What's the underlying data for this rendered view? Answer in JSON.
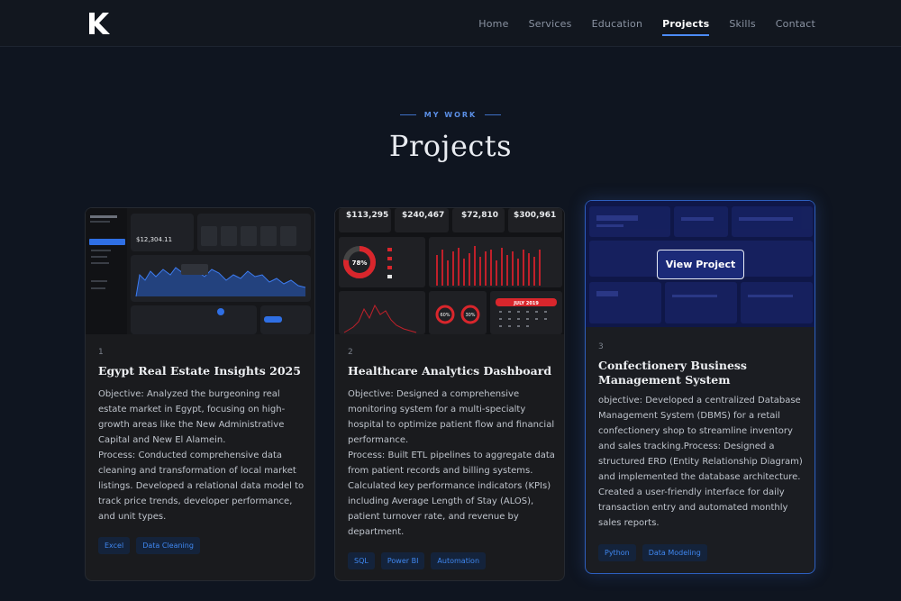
{
  "nav": {
    "items": [
      {
        "label": "Home"
      },
      {
        "label": "Services"
      },
      {
        "label": "Education"
      },
      {
        "label": "Projects",
        "active": true
      },
      {
        "label": "Skills"
      },
      {
        "label": "Contact"
      }
    ]
  },
  "section": {
    "eyebrow": "MY WORK",
    "title": "Projects"
  },
  "projects": [
    {
      "number": "1",
      "title": "Egypt Real Estate Insights 2025",
      "description": "Objective: Analyzed the burgeoning real estate market in Egypt, focusing on high-growth areas like the New Administrative Capital and New El Alamein.\nProcess: Conducted comprehensive data cleaning and transformation of local market listings. Developed a relational data model to track price trends, developer performance, and unit types.",
      "tags": [
        "Excel",
        "Data Cleaning"
      ],
      "thumb": {
        "kpi": "$12,304.11"
      }
    },
    {
      "number": "2",
      "title": "Healthcare Analytics Dashboard",
      "description": "Objective: Designed a comprehensive monitoring system for a multi-specialty hospital to optimize patient flow and financial performance.\nProcess: Built ETL pipelines to aggregate data from patient records and billing systems. Calculated key performance indicators (KPIs) including Average Length of Stay (ALOS), patient turnover rate, and revenue by department.",
      "tags": [
        "SQL",
        "Power BI",
        "Automation"
      ],
      "thumb": {
        "kpis": [
          "$113,295",
          "$240,467",
          "$72,810",
          "$300,961"
        ],
        "donut": "78%",
        "g1": "60%",
        "g2": "30%",
        "month": "JULY 2019"
      }
    },
    {
      "number": "3",
      "title": "Confectionery Business Management System",
      "description": "objective: Developed a centralized Database Management System (DBMS) for a retail confectionery shop to streamline inventory and sales tracking.Process: Designed a structured ERD (Entity Relationship Diagram) and implemented the database architecture. Created a user-friendly interface for daily transaction entry and automated monthly sales reports.",
      "tags": [
        "Python",
        "Data Modeling"
      ],
      "button": "View Project"
    }
  ],
  "colors": {
    "accent": "#4c8cf5",
    "background": "#0f1520",
    "card": "#1a1b1e"
  }
}
